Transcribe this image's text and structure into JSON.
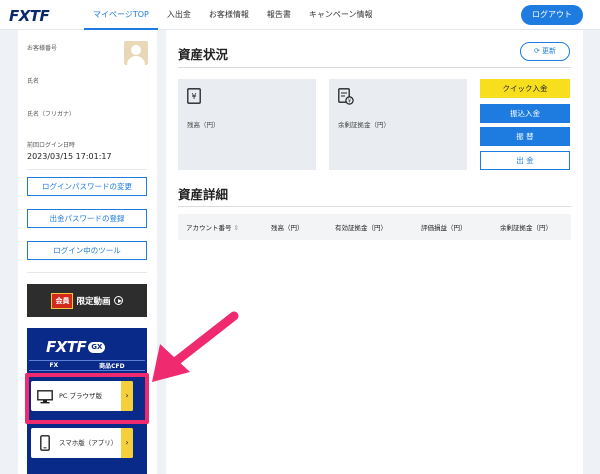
{
  "header": {
    "logo": "FXTF",
    "nav": [
      {
        "label": "マイページTOP",
        "active": true
      },
      {
        "label": "入出金",
        "active": false
      },
      {
        "label": "お客様情報",
        "active": false
      },
      {
        "label": "報告書",
        "active": false
      },
      {
        "label": "キャンペーン情報",
        "active": false
      }
    ],
    "logout_label": "ログアウト"
  },
  "sidebar": {
    "customer_number_label": "お客様番号",
    "name_label": "氏名",
    "name_kana_label": "氏名（フリガナ）",
    "last_login_label": "前回ログイン日時",
    "last_login_value": "2023/03/15 17:01:17",
    "buttons": [
      "ログインパスワードの変更",
      "出金パスワードの登録",
      "ログイン中のツール"
    ],
    "video_banner": {
      "badge": "会員",
      "text": "限定動画"
    },
    "gx_banner": {
      "logo": "FXTF",
      "logo_badge": "GX",
      "tags": [
        "FX",
        "商品CFD"
      ],
      "pc_label": "PC ブラウザ版",
      "sp_label": "スマホ版（アプリ）"
    }
  },
  "main": {
    "assets_title": "資産状況",
    "refresh_label": "更新",
    "cards": [
      {
        "icon": "yen-icon",
        "label": "残高（円）"
      },
      {
        "icon": "margin-document-icon",
        "label": "余剰証拠金（円）"
      }
    ],
    "actions": [
      "クイック入金",
      "振込入金",
      "振 替",
      "出 金"
    ],
    "details_title": "資産詳細",
    "table_headers": [
      "アカウント番号",
      "残高（円）",
      "有効証拠金（円）",
      "評価損益（円）",
      "余剰証拠金（円）"
    ]
  },
  "colors": {
    "accent": "#1e7be0",
    "brand_navy": "#0b2a6b",
    "quick_deposit": "#f7df1e",
    "annotation": "#f02a6e"
  }
}
